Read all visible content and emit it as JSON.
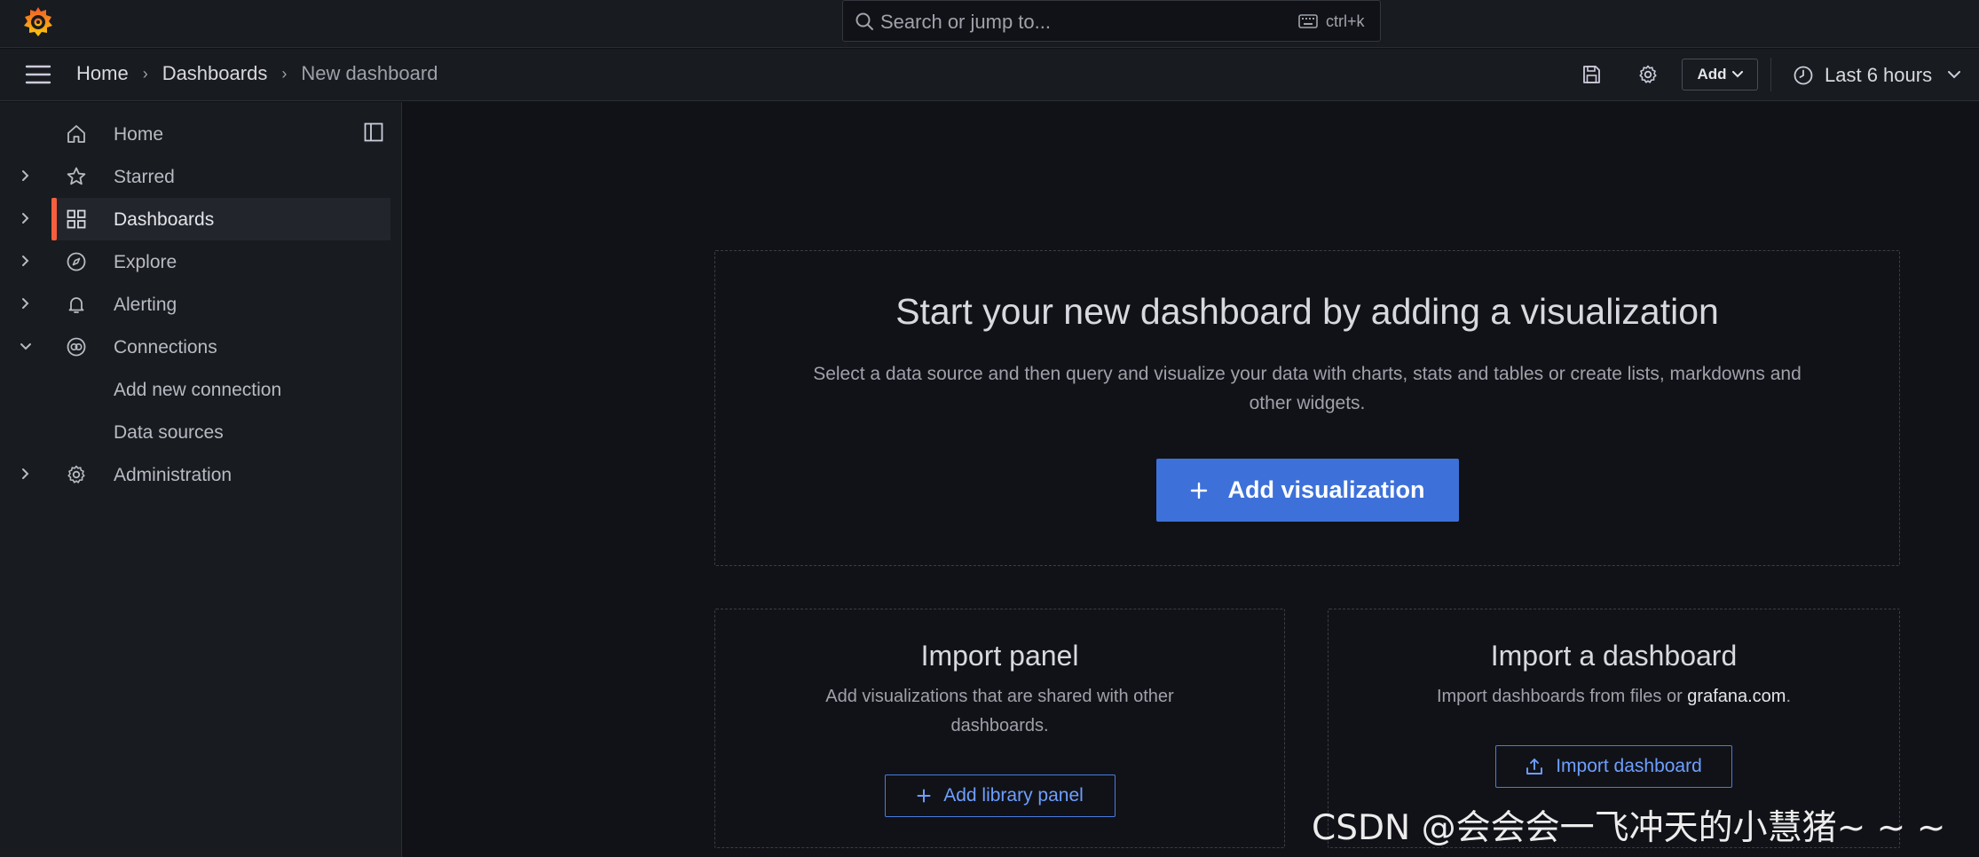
{
  "search": {
    "placeholder": "Search or jump to...",
    "shortcut": "ctrl+k"
  },
  "breadcrumbs": [
    {
      "label": "Home"
    },
    {
      "label": "Dashboards"
    },
    {
      "label": "New dashboard"
    }
  ],
  "toolbar": {
    "add_label": "Add",
    "time_range": "Last 6 hours"
  },
  "sidebar": {
    "items": [
      {
        "label": "Home",
        "icon": "home-icon"
      },
      {
        "label": "Starred",
        "icon": "star-icon"
      },
      {
        "label": "Dashboards",
        "icon": "apps-icon"
      },
      {
        "label": "Explore",
        "icon": "compass-icon"
      },
      {
        "label": "Alerting",
        "icon": "bell-icon"
      },
      {
        "label": "Connections",
        "icon": "plug-icon"
      },
      {
        "label": "Add new connection"
      },
      {
        "label": "Data sources"
      },
      {
        "label": "Administration",
        "icon": "gear-icon"
      }
    ]
  },
  "hero": {
    "title": "Start your new dashboard by adding a visualization",
    "description": "Select a data source and then query and visualize your data with charts, stats and tables or create lists, markdowns and other widgets.",
    "button": "Add visualization"
  },
  "import_panel": {
    "title": "Import panel",
    "description": "Add visualizations that are shared with other dashboards.",
    "button": "Add library panel"
  },
  "import_dashboard": {
    "title": "Import a dashboard",
    "description_prefix": "Import dashboards from files or ",
    "link": "grafana.com",
    "description_suffix": ".",
    "button": "Import dashboard"
  },
  "watermark": "CSDN @会会会一飞冲天的小慧猪~ ~ ~",
  "colors": {
    "accent": "#3d71d9",
    "active_bar": "#f55f3e",
    "background": "#111217",
    "surface": "#181b1f"
  }
}
